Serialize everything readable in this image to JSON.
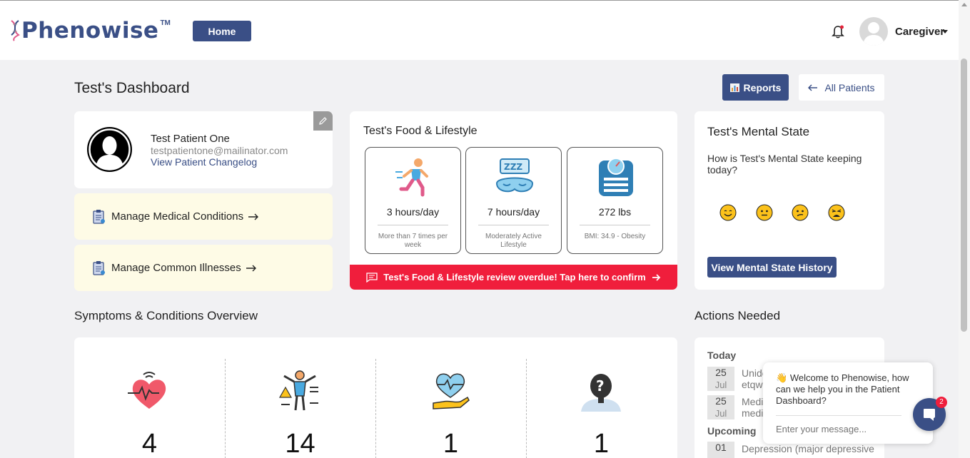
{
  "header": {
    "logo_text": "Phenowise",
    "logo_tm": "TM",
    "home_label": "Home",
    "user_label": "Caregiver"
  },
  "page": {
    "title": "Test's Dashboard",
    "reports_label": "Reports",
    "all_patients_label": "All Patients"
  },
  "patient": {
    "name": "Test Patient One",
    "email": "testpatientone@mailinator.com",
    "changelog_link": "View Patient Changelog"
  },
  "manage": [
    {
      "label": "Manage Medical Conditions"
    },
    {
      "label": "Manage Common Illnesses"
    }
  ],
  "food": {
    "title": "Test's Food & Lifestyle",
    "stats": [
      {
        "value": "3 hours/day",
        "sub": "More than 7 times per week",
        "icon": "running-icon"
      },
      {
        "value": "7 hours/day",
        "sub": "Moderately Active Lifestyle",
        "icon": "sleep-mask-icon"
      },
      {
        "value": "272 lbs",
        "sub": "BMI: 34.9 - Obesity",
        "icon": "weight-scale-icon"
      }
    ],
    "overdue_text": "Test's Food & Lifestyle review overdue! Tap here to confirm"
  },
  "mental": {
    "title": "Test's Mental State",
    "question": "How is Test's Mental State keeping today?",
    "history_label": "View Mental State History"
  },
  "symptoms": {
    "title": "Symptoms & Conditions Overview",
    "items": [
      {
        "count": "4",
        "icon": "heart-signal-icon"
      },
      {
        "count": "14",
        "icon": "body-symptoms-icon"
      },
      {
        "count": "1",
        "icon": "heart-hand-icon"
      },
      {
        "count": "1",
        "icon": "mental-question-icon"
      }
    ]
  },
  "actions": {
    "title": "Actions Needed",
    "today_label": "Today",
    "upcoming_label": "Upcoming",
    "items": [
      {
        "day": "25",
        "month": "Jul",
        "line1": "Unide",
        "line2": "etqw"
      },
      {
        "day": "25",
        "month": "Jul",
        "line1": "Medi",
        "line2": "medi"
      },
      {
        "day": "01",
        "month": "",
        "line1": "Depression (major depressive",
        "line2": ""
      }
    ]
  },
  "chat": {
    "welcome_emoji": "👋",
    "welcome": "Welcome to Phenowise, how can we help you in the Patient Dashboard?",
    "placeholder": "Enter your message...",
    "badge": "2"
  },
  "colors": {
    "brand": "#3a4f86",
    "alert": "#f01e3c",
    "yellow_card": "#fefbe6"
  }
}
